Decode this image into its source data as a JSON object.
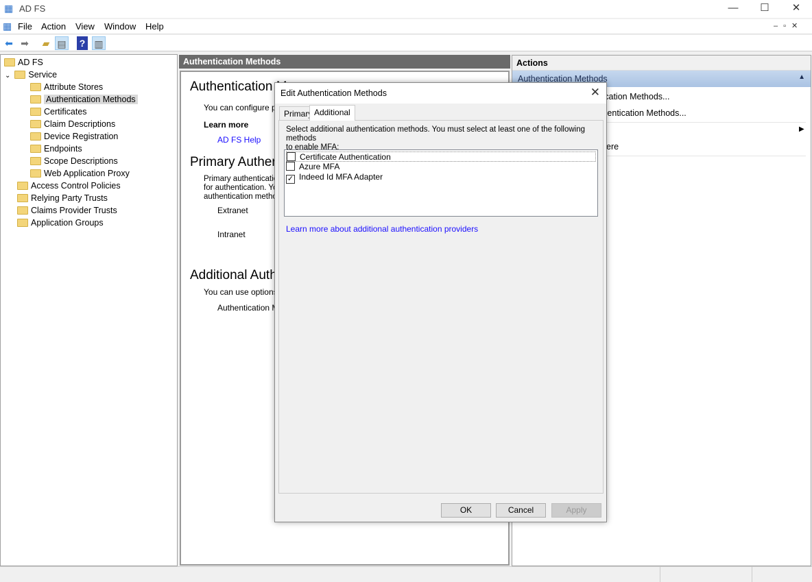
{
  "window": {
    "title": "AD FS",
    "icon": "mmc-icon"
  },
  "menu": [
    "File",
    "Action",
    "View",
    "Window",
    "Help"
  ],
  "toolbar": {
    "icons": [
      "back-icon",
      "forward-icon",
      "up-folder-icon",
      "show-hide-tree-icon",
      "help-icon",
      "show-hide-action-pane-icon"
    ]
  },
  "tree": {
    "root": "AD FS",
    "service": "Service",
    "service_children": [
      "Attribute Stores",
      "Authentication Methods",
      "Certificates",
      "Claim Descriptions",
      "Device Registration",
      "Endpoints",
      "Scope Descriptions",
      "Web Application Proxy"
    ],
    "others": [
      "Access Control Policies",
      "Relying Party Trusts",
      "Claims Provider Trusts",
      "Application Groups"
    ],
    "selected": "Authentication Methods"
  },
  "center": {
    "header": "Authentication Methods",
    "overview_title": "Authentication M",
    "overview_text": "You can configure pri",
    "learn_more": "Learn more",
    "help_link": "AD FS Help",
    "primary_title": "Primary Auther",
    "primary_text": [
      "Primary authentication",
      "for authentication. You",
      "authentication method"
    ],
    "extranet": "Extranet",
    "intranet": "Intranet",
    "additional_title": "Additional Auth",
    "additional_text": "You can use options b",
    "additional_label": "Authentication Me"
  },
  "actions": {
    "header": "Actions",
    "section": "Authentication Methods",
    "items": [
      "tication Methods...",
      "thentication Methods...",
      "",
      "Here"
    ]
  },
  "dialog": {
    "title": "Edit Authentication Methods",
    "tabs": [
      "Primary",
      "Additional"
    ],
    "active_tab": "Additional",
    "instruction": [
      "Select additional authentication methods. You must select at least one of the following methods",
      "to enable MFA:"
    ],
    "methods": [
      {
        "label": "Certificate Authentication",
        "checked": false
      },
      {
        "label": "Azure MFA",
        "checked": false
      },
      {
        "label": "Indeed Id MFA Adapter",
        "checked": true
      }
    ],
    "link": "Learn more about additional authentication providers",
    "buttons": {
      "ok": "OK",
      "cancel": "Cancel",
      "apply": "Apply"
    }
  }
}
